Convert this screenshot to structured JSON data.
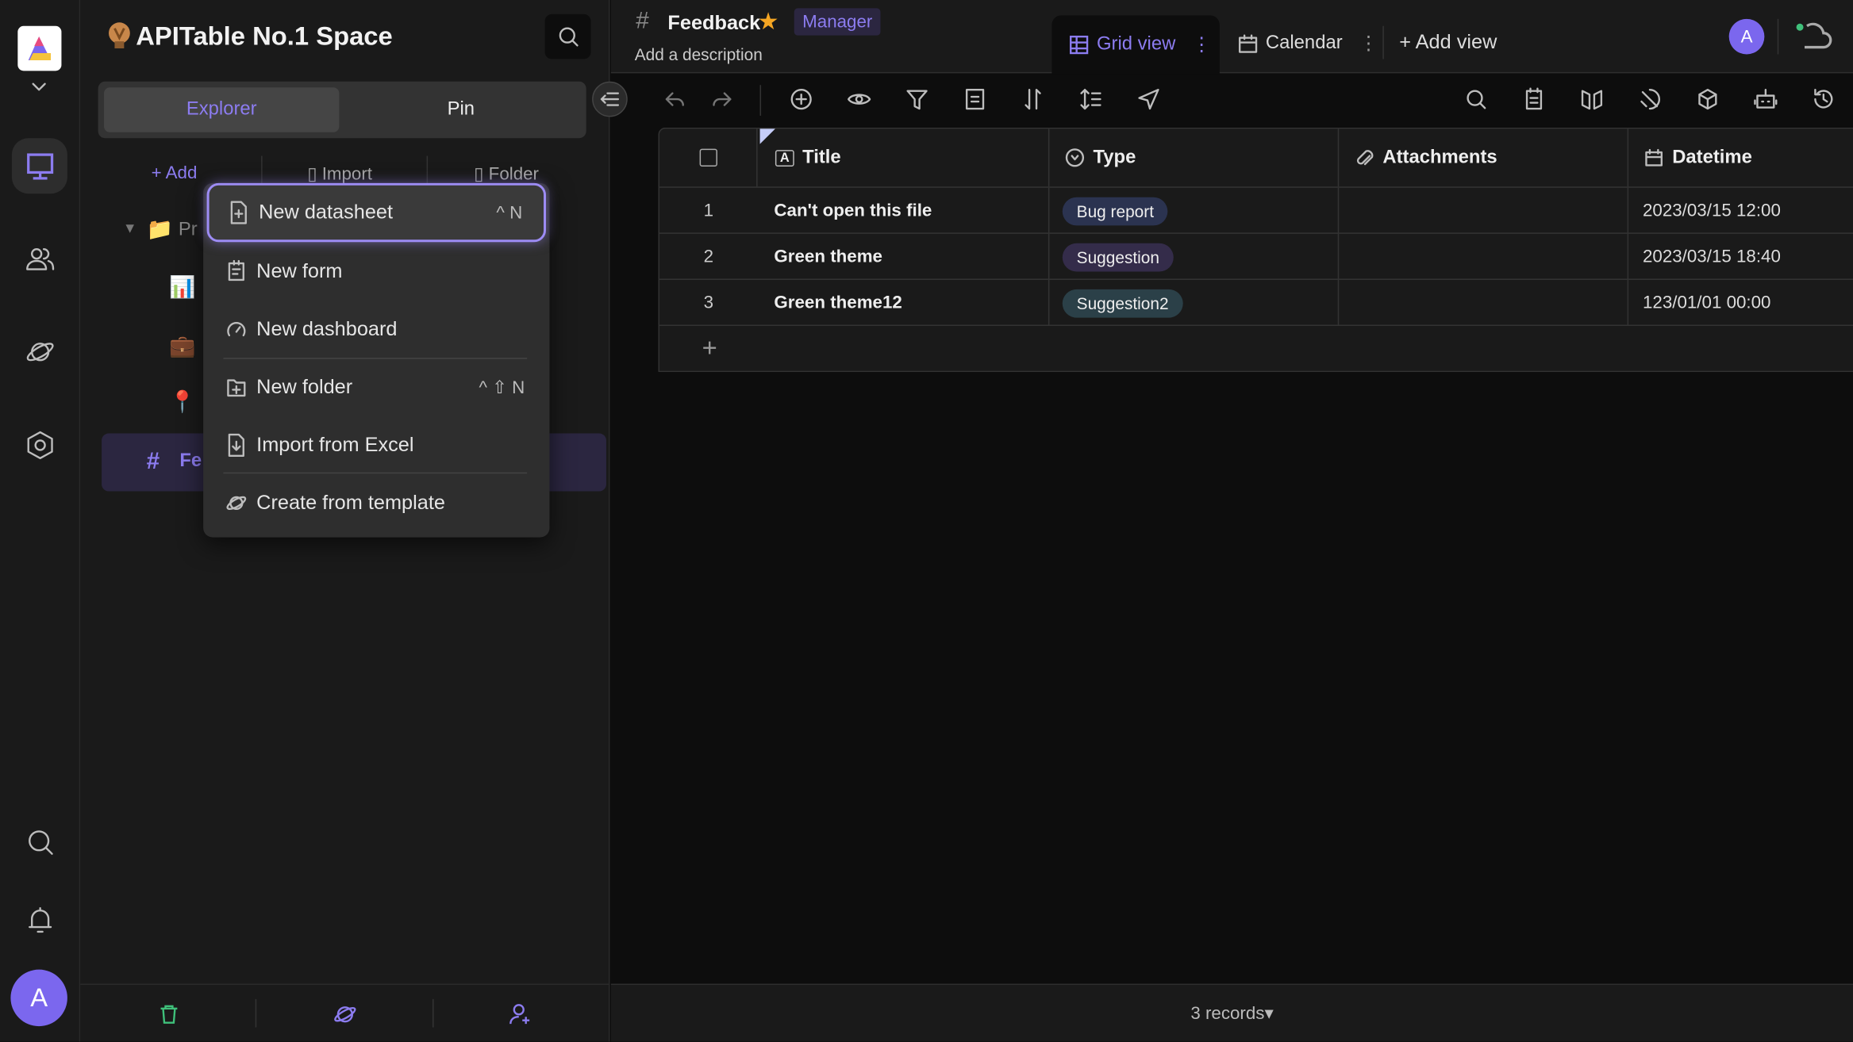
{
  "rail": {
    "avatar": "A",
    "accent": "#7b67ee"
  },
  "sidebar": {
    "space_name": "APITable No.1 Space",
    "tabs": [
      {
        "label": "Explorer",
        "active": true
      },
      {
        "label": "Pin",
        "active": false
      }
    ],
    "actions": {
      "add": "Add",
      "import": "Import",
      "folder": "Folder"
    },
    "tree": {
      "folder_label": "Pr",
      "selected_label": "Fe"
    }
  },
  "context_menu": {
    "items": [
      {
        "label": "New datasheet",
        "shortcut": "^ N",
        "icon": "file-plus-icon",
        "highlighted": true
      },
      {
        "label": "New form",
        "shortcut": "",
        "icon": "form-icon"
      },
      {
        "label": "New dashboard",
        "shortcut": "",
        "icon": "dashboard-icon"
      },
      {
        "label": "New folder",
        "shortcut": "^ ⇧ N",
        "icon": "folder-plus-icon"
      },
      {
        "label": "Import from Excel",
        "shortcut": "",
        "icon": "import-icon"
      },
      {
        "label": "Create from template",
        "shortcut": "",
        "icon": "planet-icon"
      }
    ]
  },
  "header": {
    "title": "Feedback",
    "role_badge": "Manager",
    "description": "Add a description",
    "avatar": "A",
    "views": [
      {
        "label": "Grid view",
        "active": true
      },
      {
        "label": "Calendar",
        "active": false
      }
    ],
    "add_view": "Add view"
  },
  "table": {
    "columns": [
      {
        "label": "Title",
        "icon": "text-icon"
      },
      {
        "label": "Type",
        "icon": "select-icon"
      },
      {
        "label": "Attachments",
        "icon": "paperclip-icon"
      },
      {
        "label": "Datetime",
        "icon": "calendar-icon"
      }
    ],
    "rows": [
      {
        "num": "1",
        "title": "Can't open this file",
        "type": "Bug report",
        "type_color": "#2b3350",
        "attachments": "",
        "datetime": "2023/03/15 12:00"
      },
      {
        "num": "2",
        "title": "Green theme",
        "type": "Suggestion",
        "type_color": "#342c4a",
        "attachments": "",
        "datetime": "2023/03/15 18:40"
      },
      {
        "num": "3",
        "title": "Green theme12",
        "type": "Suggestion2",
        "type_color": "#2b4048",
        "attachments": "",
        "datetime": "123/01/01 00:00"
      }
    ]
  },
  "footer": {
    "records": "3 records▾"
  }
}
